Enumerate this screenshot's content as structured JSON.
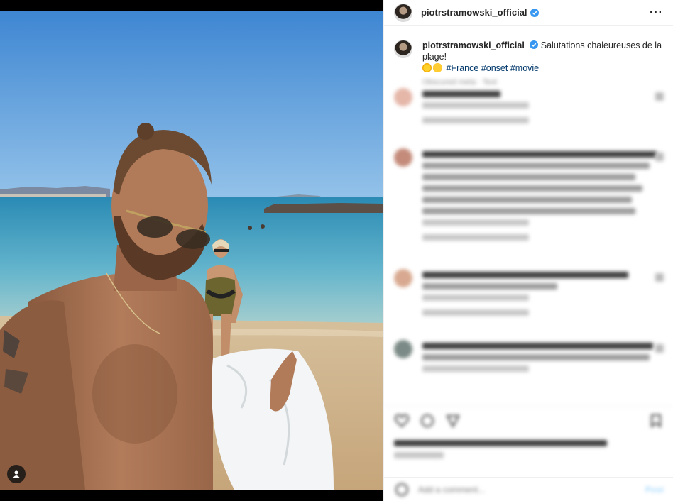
{
  "post": {
    "username": "piotrstramowski_official",
    "caption_text": "Salutations chaleureuses de la plage!",
    "hashtags": [
      "#France",
      "#onset",
      "#movie"
    ],
    "emojis": [
      "sun-emoji",
      "sunglasses-face-emoji"
    ],
    "caption_meta": "Obscured meta · Text",
    "verified": true
  },
  "comments_blurred": true,
  "comments": [
    {
      "user": "blurred",
      "lines": 1,
      "meta": "Obscured meta",
      "reply": "blurred replies"
    },
    {
      "user": "blurred",
      "lines": 6,
      "meta": "Obscured meta",
      "reply": "blurred replies"
    },
    {
      "user": "blurred",
      "lines": 2,
      "meta": "Obscured meta",
      "reply": "blurred replies"
    },
    {
      "user": "blurred",
      "lines": 3,
      "meta": "Obscured meta",
      "reply": ""
    }
  ],
  "likes_text": "blurred",
  "add_comment": {
    "placeholder": "Add a comment...",
    "post_label": "Post"
  },
  "icons": {
    "more": "more-options-icon",
    "verified": "verified-badge-icon",
    "like": "heart-icon",
    "comment": "comment-icon",
    "share": "share-icon",
    "save": "bookmark-icon",
    "tags": "user-tag-icon",
    "emoji": "emoji-icon"
  },
  "colors": {
    "verified": "#3897f0",
    "hashtag": "#00376b",
    "sea": "#2d8ab6",
    "sky": "#4b8fd3"
  }
}
